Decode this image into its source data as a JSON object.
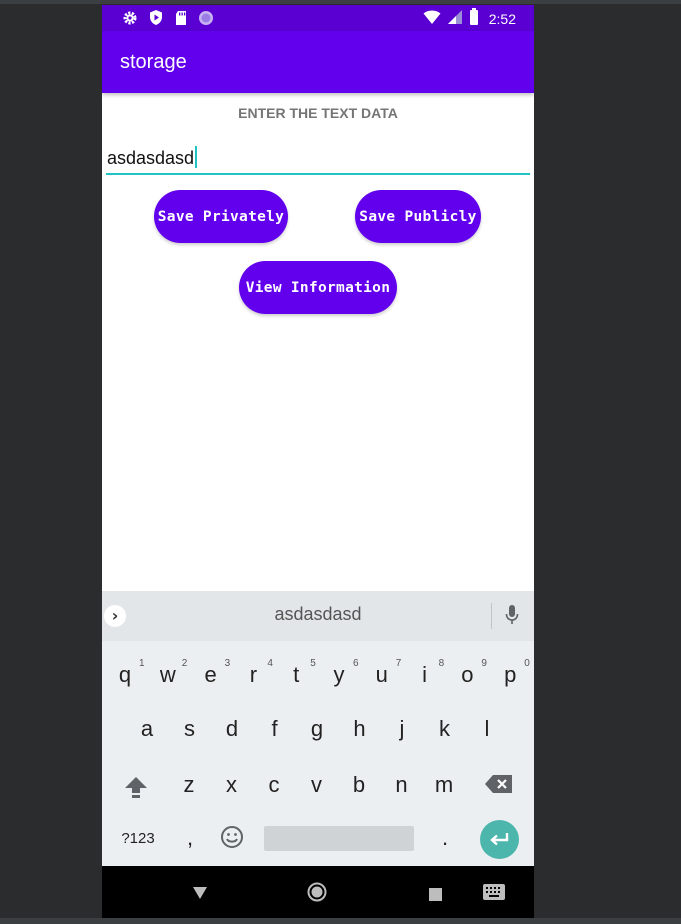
{
  "status_bar": {
    "time": "2:52",
    "icons_left": [
      "gear-icon",
      "shield-play-icon",
      "sd-card-icon",
      "circle-badge-icon"
    ],
    "icons_right": [
      "wifi-icon",
      "signal-icon",
      "battery-icon"
    ]
  },
  "app_bar": {
    "title": "storage"
  },
  "main": {
    "label": "ENTER THE TEXT DATA",
    "input_value": "asdasdasd",
    "buttons": {
      "save_private": "Save Privately",
      "save_public": "Save Publicly",
      "view_info": "View Information"
    }
  },
  "keyboard": {
    "suggestion": "asdasdasd",
    "row1": [
      "q",
      "w",
      "e",
      "r",
      "t",
      "y",
      "u",
      "i",
      "o",
      "p"
    ],
    "row1_hints": [
      "1",
      "2",
      "3",
      "4",
      "5",
      "6",
      "7",
      "8",
      "9",
      "0"
    ],
    "row2": [
      "a",
      "s",
      "d",
      "f",
      "g",
      "h",
      "j",
      "k",
      "l"
    ],
    "row3": [
      "z",
      "x",
      "c",
      "v",
      "b",
      "n",
      "m"
    ],
    "symbols_key": "?123",
    "comma_key": ",",
    "period_key": "."
  },
  "colors": {
    "primary": "#6200ee",
    "status_bar": "#5a00d3",
    "accent": "#20c4c4",
    "enter_key": "#4db6ac"
  }
}
